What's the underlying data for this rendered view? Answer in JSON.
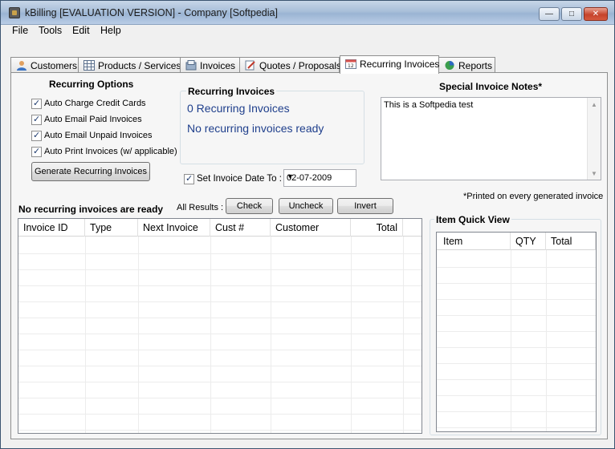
{
  "window": {
    "title": "kBilling [EVALUATION VERSION] - Company [Softpedia]",
    "controls": {
      "minimize": "—",
      "maximize": "□",
      "close": "✕"
    }
  },
  "menu": [
    "File",
    "Tools",
    "Edit",
    "Help"
  ],
  "tabs": [
    {
      "label": "Customers",
      "icon": "customers-icon"
    },
    {
      "label": "Products / Services",
      "icon": "products-icon"
    },
    {
      "label": "Invoices",
      "icon": "invoices-icon"
    },
    {
      "label": "Quotes / Proposals",
      "icon": "quotes-icon"
    },
    {
      "label": "Recurring Invoices",
      "icon": "recurring-icon",
      "active": true
    },
    {
      "label": "Reports",
      "icon": "reports-icon"
    }
  ],
  "recurring_options": {
    "heading": "Recurring Options",
    "checkboxes": [
      {
        "label": "Auto Charge Credit Cards",
        "checked": true
      },
      {
        "label": "Auto Email Paid Invoices",
        "checked": true
      },
      {
        "label": "Auto Email Unpaid Invoices",
        "checked": true
      },
      {
        "label": "Auto Print Invoices (w/ applicable)",
        "checked": true
      }
    ],
    "generate_button": "Generate Recurring Invoices"
  },
  "recurring_summary": {
    "heading": "Recurring Invoices",
    "count_text": "0 Recurring Invoices",
    "status_text": "No recurring invoices ready"
  },
  "invoice_date": {
    "label": "Set Invoice Date To :",
    "checked": true,
    "value": "02-07-2009"
  },
  "notes": {
    "heading": "Special Invoice Notes*",
    "text": "This is a Softpedia test",
    "footnote": "*Printed on every generated invoice"
  },
  "results": {
    "heading": "No recurring invoices are ready",
    "all_results_label": "All Results :",
    "buttons": {
      "check": "Check",
      "uncheck": "Uncheck",
      "invert": "Invert"
    },
    "columns": [
      "Invoice ID",
      "Type",
      "Next Invoice",
      "Cust #",
      "Customer",
      "Total"
    ]
  },
  "quick_view": {
    "heading": "Item Quick View",
    "columns": [
      "Item",
      "QTY",
      "Total"
    ]
  },
  "colors": {
    "link_blue": "#1f3f8c",
    "title_gradient_top": "#c7d6e8",
    "close_red": "#c6432b"
  }
}
